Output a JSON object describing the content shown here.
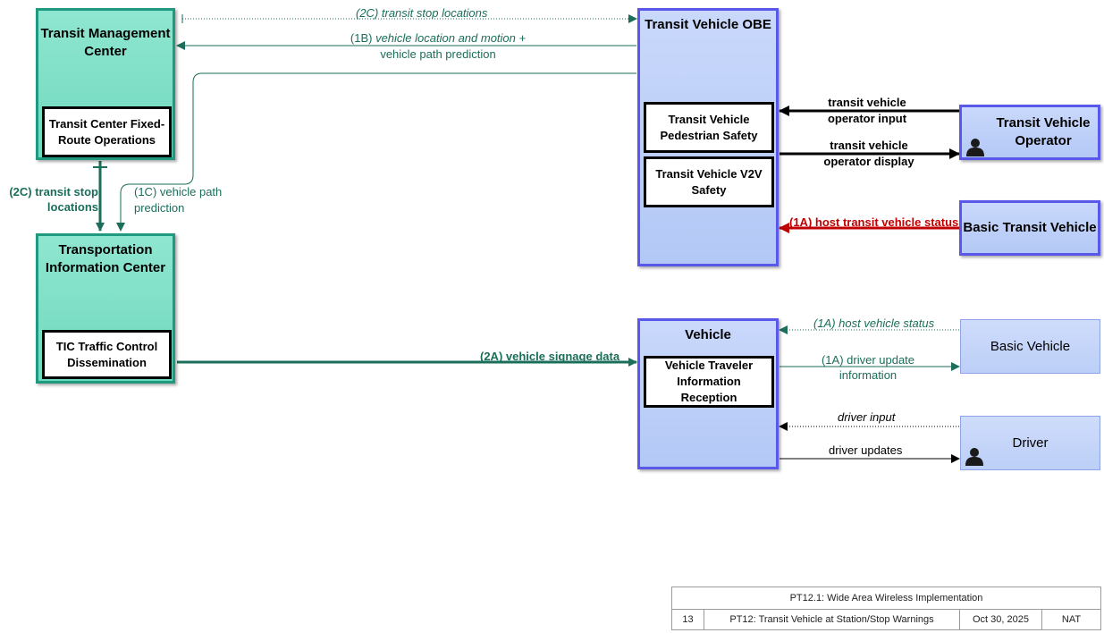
{
  "boxes": {
    "tmc": {
      "title": "Transit Management Center",
      "inner": "Transit Center Fixed-Route Operations"
    },
    "tic": {
      "title": "Transportation Information Center",
      "inner": "TIC Traffic Control Dissemination"
    },
    "tv_obe": {
      "title": "Transit Vehicle OBE",
      "inner1": "Transit Vehicle Pedestrian Safety",
      "inner2": "Transit Vehicle V2V Safety"
    },
    "vehicle": {
      "title": "Vehicle",
      "inner": "Vehicle Traveler Information Reception"
    },
    "tv_operator": {
      "title": "Transit Vehicle Operator",
      "icon": "person-icon"
    },
    "basic_transit_vehicle": {
      "title": "Basic Transit Vehicle"
    },
    "basic_vehicle": {
      "title": "Basic Vehicle"
    },
    "driver": {
      "title": "Driver",
      "icon": "person-icon"
    }
  },
  "flows": {
    "f_2c_top": "(2C) transit stop locations",
    "f_1b": "(1B) vehicle location and motion +",
    "f_1b_2": "vehicle path prediction",
    "f_2c_left": "(2C) transit stop",
    "f_2c_left_2": "locations",
    "f_1c": "(1C) vehicle path",
    "f_1c_2": "prediction",
    "f_op_input": "transit vehicle",
    "f_op_input_2": "operator input",
    "f_op_display": "transit vehicle",
    "f_op_display_2": "operator display",
    "f_1a_host_transit": "(1A) host transit vehicle status",
    "f_2a": "(2A) vehicle signage data",
    "f_1a_host_vehicle": "(1A) host vehicle status",
    "f_1a_driver_update": "(1A) driver update",
    "f_1a_driver_update_2": "information",
    "f_driver_input": "driver input",
    "f_driver_updates": "driver updates"
  },
  "footer": {
    "title": "PT12.1: Wide Area Wireless Implementation",
    "page": "13",
    "name": "PT12: Transit Vehicle at Station/Stop Warnings",
    "date": "Oct 30, 2025",
    "tag": "NAT"
  },
  "colors": {
    "teal_flow": "#1a6e5a",
    "red_flow": "#c00000",
    "center_fill": "#7fdfc6",
    "obe_fill": "#bccff7",
    "obe_border": "#5a58e8"
  }
}
